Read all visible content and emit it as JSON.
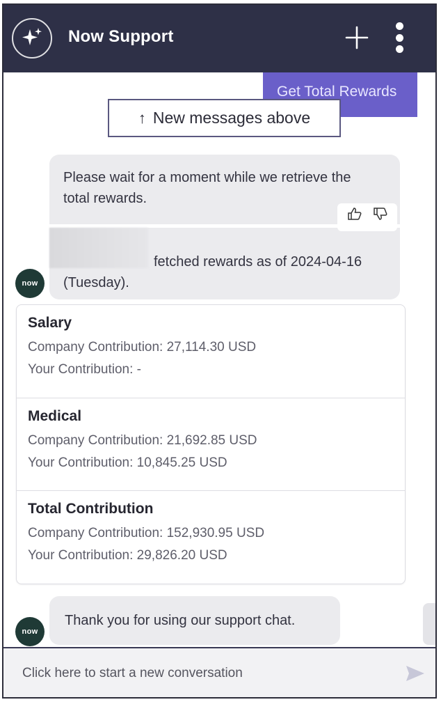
{
  "header": {
    "title": "Now Support",
    "logo_icon": "sparkle-icon",
    "new_conversation_icon": "plus-icon",
    "more_icon": "more-vertical-icon",
    "background_color": "#2e3047"
  },
  "chat": {
    "user_message": "Get Total Rewards",
    "new_messages_button": "New messages above",
    "new_messages_arrow": "↑",
    "avatar_text": "now",
    "bot_message_1": "Please wait for a moment while we retrieve the total rewards.",
    "bot_message_1b": "fetched rewards as of 2024-04-16 (Tuesday).",
    "feedback": {
      "thumbs_up_icon": "thumbs-up-icon",
      "thumbs_down_icon": "thumbs-down-icon"
    },
    "rewards_card": [
      {
        "title": "Salary",
        "company_contribution": "Company Contribution: 27,114.30 USD",
        "your_contribution": "Your Contribution: -"
      },
      {
        "title": "Medical",
        "company_contribution": "Company Contribution: 21,692.85 USD",
        "your_contribution": "Your Contribution: 10,845.25 USD"
      },
      {
        "title": "Total Contribution",
        "company_contribution": "Company Contribution: 152,930.95 USD",
        "your_contribution": "Your Contribution: 29,826.20 USD"
      }
    ],
    "bot_message_2": "Thank you for using our support chat."
  },
  "composer": {
    "placeholder": "Click here to start a new conversation",
    "send_icon": "send-icon"
  },
  "colors": {
    "accent": "#6a5fc9",
    "bubble": "#ebebee",
    "avatar": "#1f3a36"
  }
}
